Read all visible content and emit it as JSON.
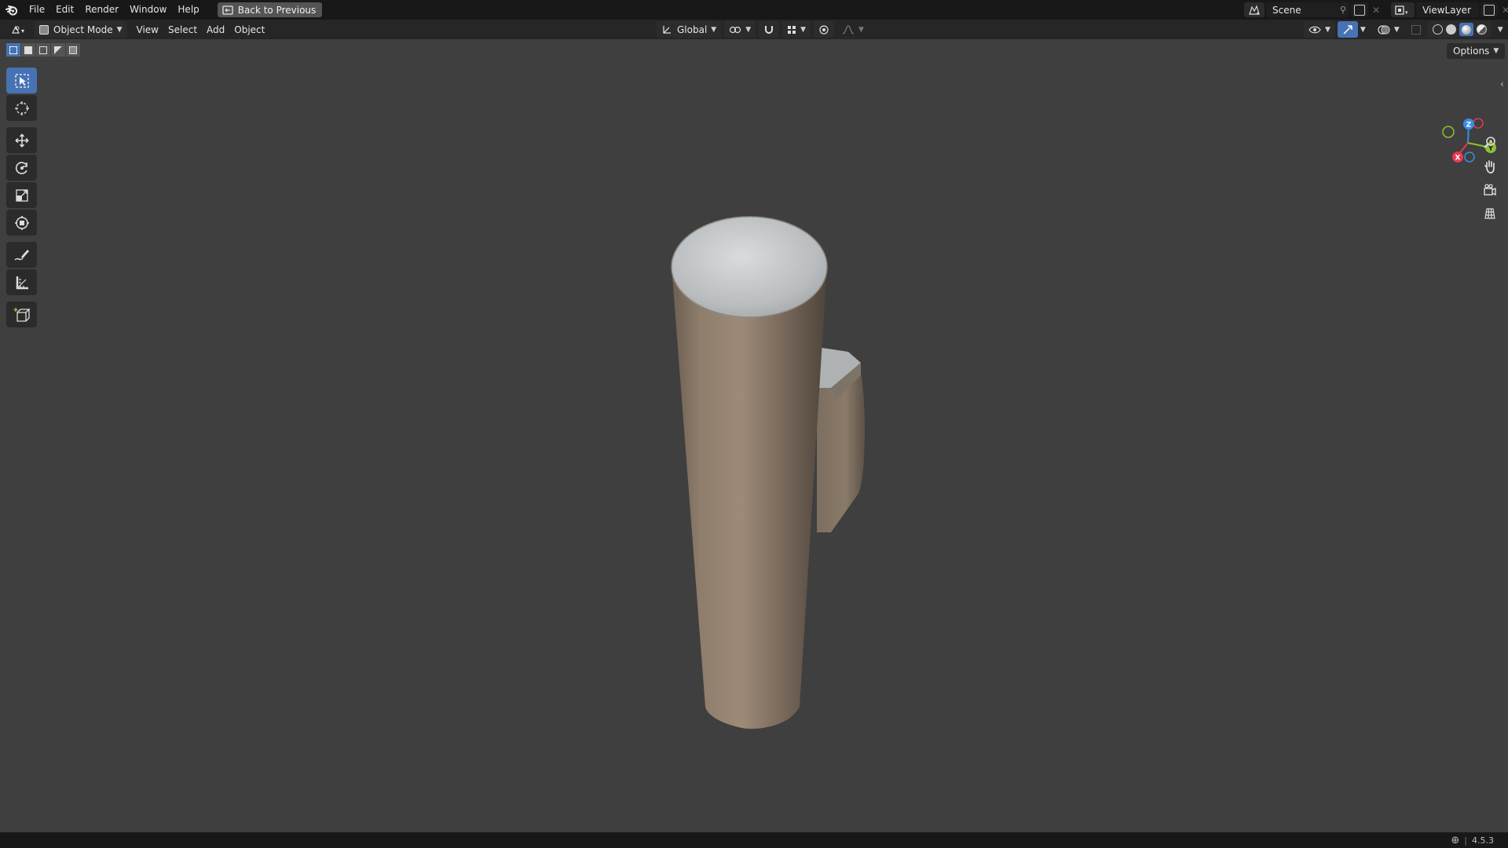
{
  "menu": {
    "items": [
      "File",
      "Edit",
      "Render",
      "Window",
      "Help"
    ],
    "back_button": "Back to Previous"
  },
  "scene": {
    "name": "Scene"
  },
  "view_layer": {
    "name": "ViewLayer"
  },
  "header": {
    "mode": "Object Mode",
    "menus": [
      "View",
      "Select",
      "Add",
      "Object"
    ],
    "orientation": "Global"
  },
  "viewport": {
    "options_label": "Options",
    "gizmo_axes": [
      "Z",
      "Y",
      "X"
    ]
  },
  "tools": [
    {
      "name": "select-box-tool",
      "icon": "select-box-icon"
    },
    {
      "name": "cursor-tool",
      "icon": "cursor-icon"
    },
    {
      "name": "move-tool",
      "icon": "move-icon"
    },
    {
      "name": "rotate-tool",
      "icon": "rotate-icon"
    },
    {
      "name": "scale-tool",
      "icon": "scale-icon"
    },
    {
      "name": "transform-tool",
      "icon": "transform-icon"
    },
    {
      "name": "annotate-tool",
      "icon": "annotate-icon"
    },
    {
      "name": "measure-tool",
      "icon": "measure-icon"
    },
    {
      "name": "add-cube-tool",
      "icon": "add-cube-icon"
    }
  ],
  "status": {
    "version": "4.5.3"
  },
  "colors": {
    "accent": "#4772b3",
    "axis_x": "#e5394f",
    "axis_y": "#8bc136",
    "axis_z": "#3a8ee6"
  }
}
